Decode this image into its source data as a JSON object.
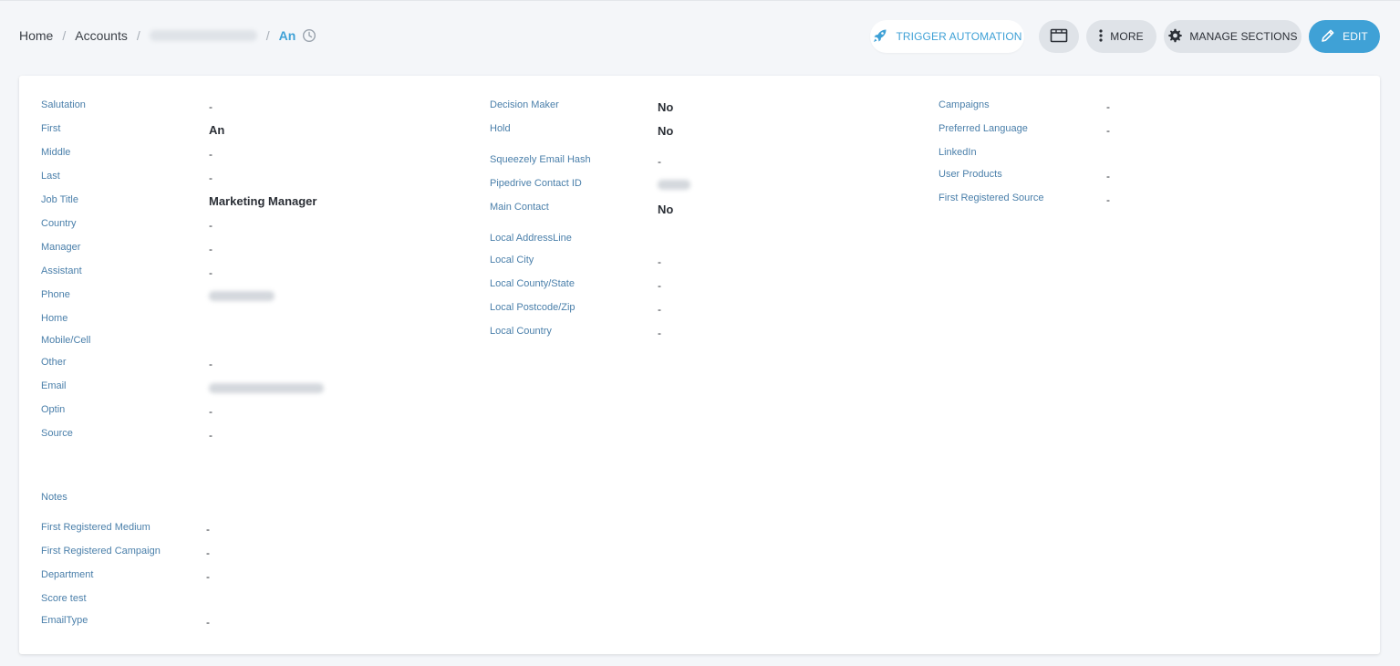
{
  "breadcrumb": {
    "home": "Home",
    "accounts": "Accounts",
    "current": "An"
  },
  "toolbar": {
    "trigger_label": "TRIGGER AUTOMATION",
    "more_label": "MORE",
    "manage_label": "MANAGE SECTIONS",
    "edit_label": "EDIT"
  },
  "icons": {
    "trigger": "rocket-icon",
    "view": "window-icon",
    "more": "vertical-dots-icon",
    "manage": "gear-icon",
    "edit": "pencil-icon",
    "history": "clock-icon"
  },
  "colors": {
    "accent": "#3fa1d6",
    "label": "#4a7faa",
    "button_gray": "#dfe3e8",
    "background": "#f4f6f9"
  },
  "col1": [
    {
      "label": "Salutation",
      "value": "-"
    },
    {
      "label": "First",
      "value": "An"
    },
    {
      "label": "Middle",
      "value": "-"
    },
    {
      "label": "Last",
      "value": "-"
    },
    {
      "label": "Job Title",
      "value": "Marketing Manager"
    },
    {
      "label": "Country",
      "value": "-"
    },
    {
      "label": "Manager",
      "value": "-"
    },
    {
      "label": "Assistant",
      "value": "-"
    },
    {
      "label": "Phone",
      "value": ""
    },
    {
      "label": "Home",
      "value": ""
    },
    {
      "label": "Mobile/Cell",
      "value": ""
    },
    {
      "label": "Other",
      "value": "-"
    },
    {
      "label": "Email",
      "value": ""
    },
    {
      "label": "Optin",
      "value": "-"
    },
    {
      "label": "Source",
      "value": "-"
    }
  ],
  "col1_lower": [
    {
      "label": "Notes",
      "value": ""
    },
    {
      "label": "First Registered Medium",
      "value": "-"
    },
    {
      "label": "First Registered Campaign",
      "value": "-"
    },
    {
      "label": "Department",
      "value": "-"
    },
    {
      "label": "Score test",
      "value": ""
    },
    {
      "label": "EmailType",
      "value": "-"
    }
  ],
  "col2": [
    {
      "label": "Decision Maker",
      "value": "No"
    },
    {
      "label": "Hold",
      "value": "No"
    },
    {
      "label": "Squeezely Email Hash",
      "value": "-"
    },
    {
      "label": "Pipedrive Contact ID",
      "value": ""
    },
    {
      "label": "Main Contact",
      "value": "No"
    },
    {
      "label": "Local AddressLine",
      "value": ""
    },
    {
      "label": "Local City",
      "value": "-"
    },
    {
      "label": "Local County/State",
      "value": "-"
    },
    {
      "label": "Local Postcode/Zip",
      "value": "-"
    },
    {
      "label": "Local Country",
      "value": "-"
    }
  ],
  "col3": [
    {
      "label": "Campaigns",
      "value": "-"
    },
    {
      "label": "Preferred Language",
      "value": "-"
    },
    {
      "label": "LinkedIn",
      "value": ""
    },
    {
      "label": "User Products",
      "value": "-"
    },
    {
      "label": "First Registered Source",
      "value": "-"
    }
  ]
}
